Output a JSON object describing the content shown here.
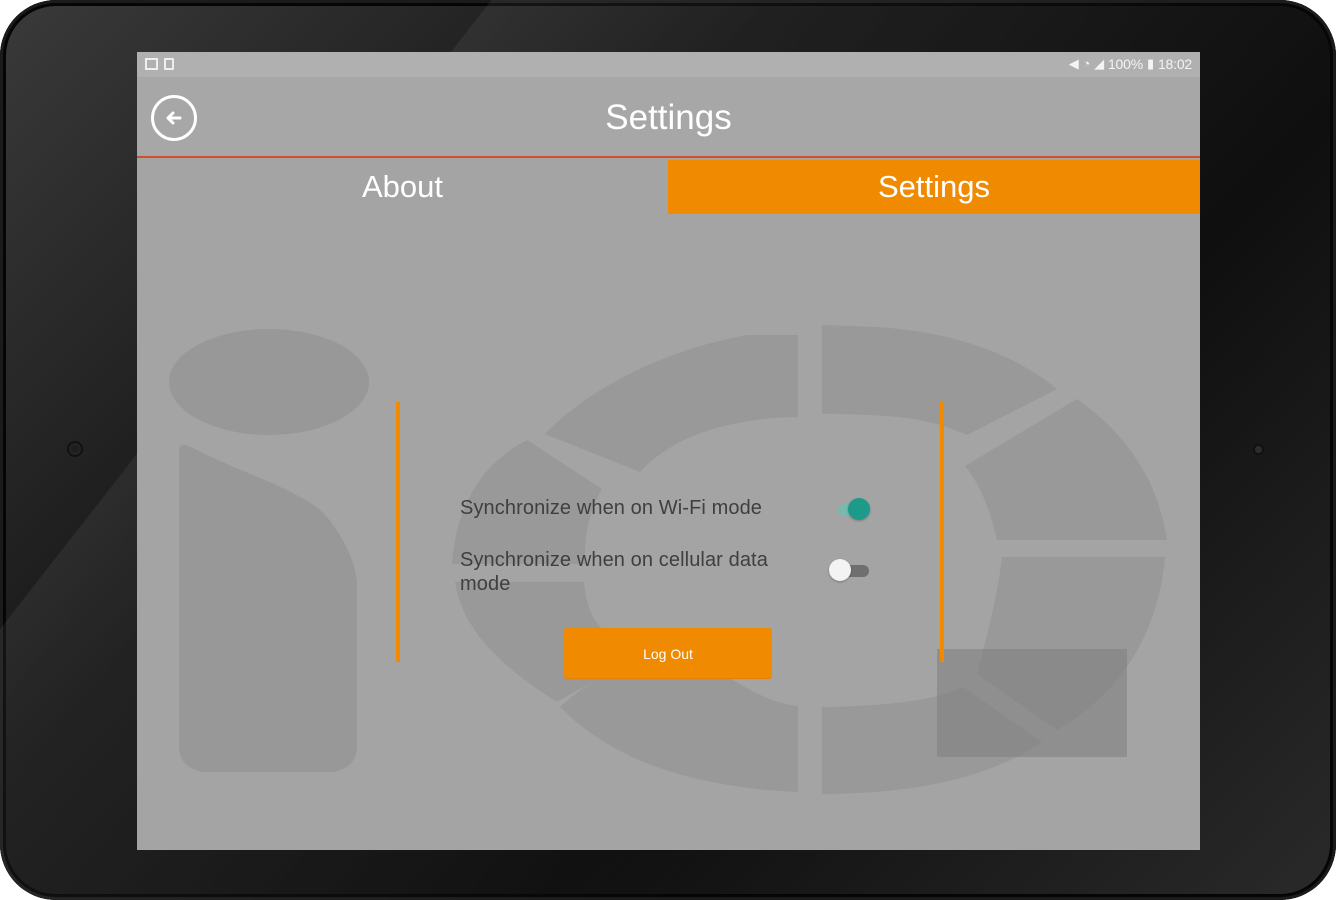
{
  "status_bar": {
    "battery_text": "100%",
    "time": "18:02",
    "left_icons": [
      "image-icon",
      "sdcard-icon"
    ],
    "right_icons": [
      "mute-icon",
      "wifi-icon",
      "signal-icon",
      "battery-icon"
    ]
  },
  "header": {
    "title": "Settings",
    "back_icon": "back-arrow-icon"
  },
  "tabs": [
    {
      "label": "About",
      "active": false
    },
    {
      "label": "Settings",
      "active": true
    }
  ],
  "settings": {
    "wifi_label": "Synchronize when on Wi-Fi mode",
    "wifi_enabled": true,
    "cellular_label": "Synchronize when on cellular data mode",
    "cellular_enabled": false,
    "logout_label": "Log Out"
  },
  "colors": {
    "accent": "#f08a00",
    "divider": "#d44d2a",
    "toggle_on": "#1c9b8a",
    "background": "#a4a4a4"
  }
}
